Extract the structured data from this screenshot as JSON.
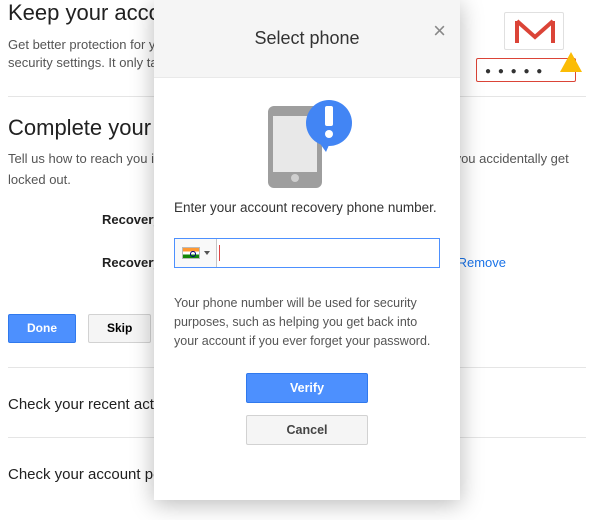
{
  "background": {
    "hero_title": "Keep your account secure.",
    "hero_sub": "Get better protection for your account by updating your security settings. It only takes a few minutes.",
    "section_title": "Complete your recovery info.",
    "section_sub": "Tell us how to reach you in case we detect unusual activity in your account or you accidentally get locked out.",
    "rows": {
      "phone_label": "Recovery phone",
      "email_label": "Recovery email"
    },
    "remove_label": "Remove",
    "done_label": "Done",
    "skip_label": "Skip",
    "link1": "Check your recent activity",
    "link2": "Check your account permissions"
  },
  "modal": {
    "title": "Select phone",
    "prompt": "Enter your account recovery phone number.",
    "phone_value": "",
    "info": "Your phone number will be used for security purposes, such as helping you get back into your account if you ever forget your password.",
    "verify_label": "Verify",
    "cancel_label": "Cancel",
    "country": "India"
  }
}
